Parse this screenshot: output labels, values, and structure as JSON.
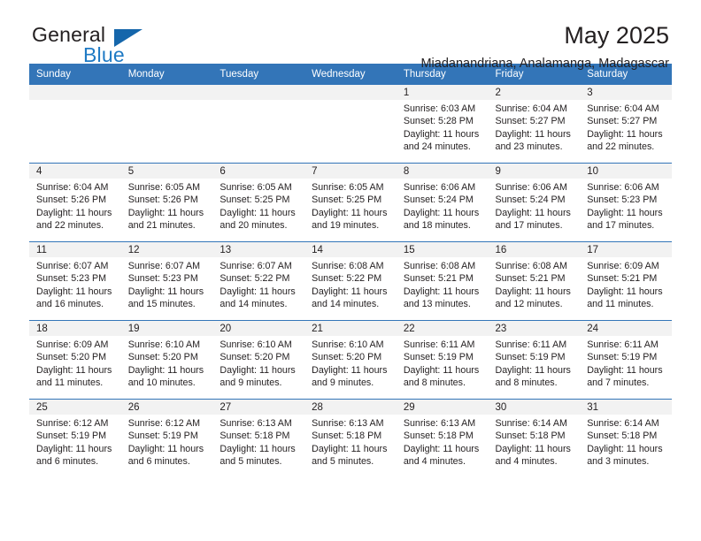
{
  "brand": {
    "name_part1": "General",
    "name_part2": "Blue",
    "logo_icon": "triangle-flag-icon",
    "accent_color": "#1566ab",
    "text_color": "#1f7ac4"
  },
  "header": {
    "title": "May 2025",
    "location": "Miadanandriana, Analamanga, Madagascar",
    "header_bg_color": "#3375b8",
    "header_text_color": "#ffffff"
  },
  "calendar": {
    "weekday_headers": [
      "Sunday",
      "Monday",
      "Tuesday",
      "Wednesday",
      "Thursday",
      "Friday",
      "Saturday"
    ],
    "weeks": [
      [
        {
          "day": "",
          "empty": true
        },
        {
          "day": "",
          "empty": true
        },
        {
          "day": "",
          "empty": true
        },
        {
          "day": "",
          "empty": true
        },
        {
          "day": "1",
          "sunrise": "Sunrise: 6:03 AM",
          "sunset": "Sunset: 5:28 PM",
          "daylight1": "Daylight: 11 hours",
          "daylight2": "and 24 minutes."
        },
        {
          "day": "2",
          "sunrise": "Sunrise: 6:04 AM",
          "sunset": "Sunset: 5:27 PM",
          "daylight1": "Daylight: 11 hours",
          "daylight2": "and 23 minutes."
        },
        {
          "day": "3",
          "sunrise": "Sunrise: 6:04 AM",
          "sunset": "Sunset: 5:27 PM",
          "daylight1": "Daylight: 11 hours",
          "daylight2": "and 22 minutes."
        }
      ],
      [
        {
          "day": "4",
          "sunrise": "Sunrise: 6:04 AM",
          "sunset": "Sunset: 5:26 PM",
          "daylight1": "Daylight: 11 hours",
          "daylight2": "and 22 minutes."
        },
        {
          "day": "5",
          "sunrise": "Sunrise: 6:05 AM",
          "sunset": "Sunset: 5:26 PM",
          "daylight1": "Daylight: 11 hours",
          "daylight2": "and 21 minutes."
        },
        {
          "day": "6",
          "sunrise": "Sunrise: 6:05 AM",
          "sunset": "Sunset: 5:25 PM",
          "daylight1": "Daylight: 11 hours",
          "daylight2": "and 20 minutes."
        },
        {
          "day": "7",
          "sunrise": "Sunrise: 6:05 AM",
          "sunset": "Sunset: 5:25 PM",
          "daylight1": "Daylight: 11 hours",
          "daylight2": "and 19 minutes."
        },
        {
          "day": "8",
          "sunrise": "Sunrise: 6:06 AM",
          "sunset": "Sunset: 5:24 PM",
          "daylight1": "Daylight: 11 hours",
          "daylight2": "and 18 minutes."
        },
        {
          "day": "9",
          "sunrise": "Sunrise: 6:06 AM",
          "sunset": "Sunset: 5:24 PM",
          "daylight1": "Daylight: 11 hours",
          "daylight2": "and 17 minutes."
        },
        {
          "day": "10",
          "sunrise": "Sunrise: 6:06 AM",
          "sunset": "Sunset: 5:23 PM",
          "daylight1": "Daylight: 11 hours",
          "daylight2": "and 17 minutes."
        }
      ],
      [
        {
          "day": "11",
          "sunrise": "Sunrise: 6:07 AM",
          "sunset": "Sunset: 5:23 PM",
          "daylight1": "Daylight: 11 hours",
          "daylight2": "and 16 minutes."
        },
        {
          "day": "12",
          "sunrise": "Sunrise: 6:07 AM",
          "sunset": "Sunset: 5:23 PM",
          "daylight1": "Daylight: 11 hours",
          "daylight2": "and 15 minutes."
        },
        {
          "day": "13",
          "sunrise": "Sunrise: 6:07 AM",
          "sunset": "Sunset: 5:22 PM",
          "daylight1": "Daylight: 11 hours",
          "daylight2": "and 14 minutes."
        },
        {
          "day": "14",
          "sunrise": "Sunrise: 6:08 AM",
          "sunset": "Sunset: 5:22 PM",
          "daylight1": "Daylight: 11 hours",
          "daylight2": "and 14 minutes."
        },
        {
          "day": "15",
          "sunrise": "Sunrise: 6:08 AM",
          "sunset": "Sunset: 5:21 PM",
          "daylight1": "Daylight: 11 hours",
          "daylight2": "and 13 minutes."
        },
        {
          "day": "16",
          "sunrise": "Sunrise: 6:08 AM",
          "sunset": "Sunset: 5:21 PM",
          "daylight1": "Daylight: 11 hours",
          "daylight2": "and 12 minutes."
        },
        {
          "day": "17",
          "sunrise": "Sunrise: 6:09 AM",
          "sunset": "Sunset: 5:21 PM",
          "daylight1": "Daylight: 11 hours",
          "daylight2": "and 11 minutes."
        }
      ],
      [
        {
          "day": "18",
          "sunrise": "Sunrise: 6:09 AM",
          "sunset": "Sunset: 5:20 PM",
          "daylight1": "Daylight: 11 hours",
          "daylight2": "and 11 minutes."
        },
        {
          "day": "19",
          "sunrise": "Sunrise: 6:10 AM",
          "sunset": "Sunset: 5:20 PM",
          "daylight1": "Daylight: 11 hours",
          "daylight2": "and 10 minutes."
        },
        {
          "day": "20",
          "sunrise": "Sunrise: 6:10 AM",
          "sunset": "Sunset: 5:20 PM",
          "daylight1": "Daylight: 11 hours",
          "daylight2": "and 9 minutes."
        },
        {
          "day": "21",
          "sunrise": "Sunrise: 6:10 AM",
          "sunset": "Sunset: 5:20 PM",
          "daylight1": "Daylight: 11 hours",
          "daylight2": "and 9 minutes."
        },
        {
          "day": "22",
          "sunrise": "Sunrise: 6:11 AM",
          "sunset": "Sunset: 5:19 PM",
          "daylight1": "Daylight: 11 hours",
          "daylight2": "and 8 minutes."
        },
        {
          "day": "23",
          "sunrise": "Sunrise: 6:11 AM",
          "sunset": "Sunset: 5:19 PM",
          "daylight1": "Daylight: 11 hours",
          "daylight2": "and 8 minutes."
        },
        {
          "day": "24",
          "sunrise": "Sunrise: 6:11 AM",
          "sunset": "Sunset: 5:19 PM",
          "daylight1": "Daylight: 11 hours",
          "daylight2": "and 7 minutes."
        }
      ],
      [
        {
          "day": "25",
          "sunrise": "Sunrise: 6:12 AM",
          "sunset": "Sunset: 5:19 PM",
          "daylight1": "Daylight: 11 hours",
          "daylight2": "and 6 minutes."
        },
        {
          "day": "26",
          "sunrise": "Sunrise: 6:12 AM",
          "sunset": "Sunset: 5:19 PM",
          "daylight1": "Daylight: 11 hours",
          "daylight2": "and 6 minutes."
        },
        {
          "day": "27",
          "sunrise": "Sunrise: 6:13 AM",
          "sunset": "Sunset: 5:18 PM",
          "daylight1": "Daylight: 11 hours",
          "daylight2": "and 5 minutes."
        },
        {
          "day": "28",
          "sunrise": "Sunrise: 6:13 AM",
          "sunset": "Sunset: 5:18 PM",
          "daylight1": "Daylight: 11 hours",
          "daylight2": "and 5 minutes."
        },
        {
          "day": "29",
          "sunrise": "Sunrise: 6:13 AM",
          "sunset": "Sunset: 5:18 PM",
          "daylight1": "Daylight: 11 hours",
          "daylight2": "and 4 minutes."
        },
        {
          "day": "30",
          "sunrise": "Sunrise: 6:14 AM",
          "sunset": "Sunset: 5:18 PM",
          "daylight1": "Daylight: 11 hours",
          "daylight2": "and 4 minutes."
        },
        {
          "day": "31",
          "sunrise": "Sunrise: 6:14 AM",
          "sunset": "Sunset: 5:18 PM",
          "daylight1": "Daylight: 11 hours",
          "daylight2": "and 3 minutes."
        }
      ]
    ]
  }
}
